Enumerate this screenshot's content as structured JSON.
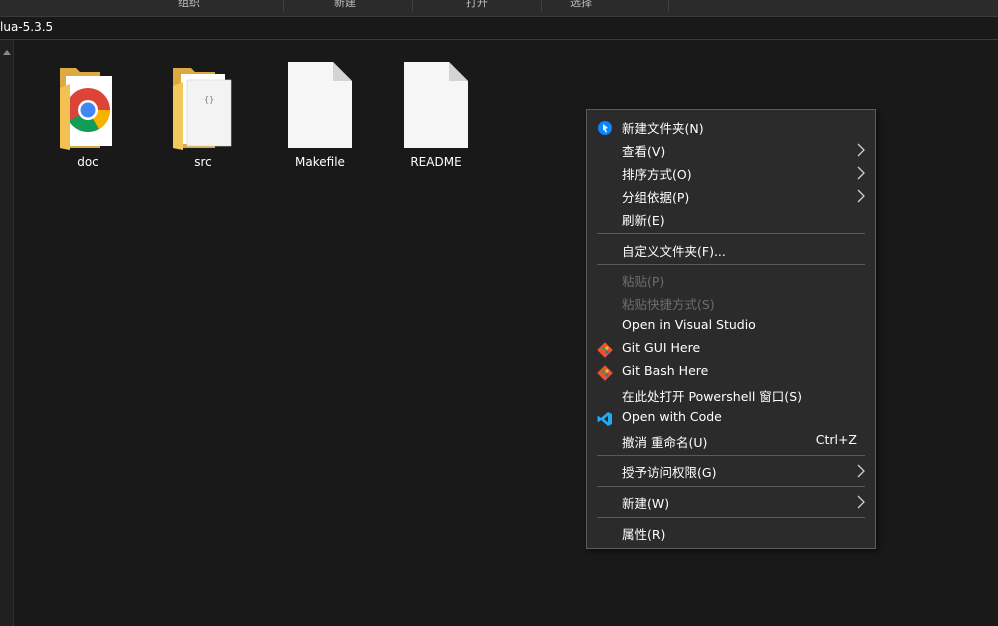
{
  "ribbon": {
    "items": [
      "组织",
      "新建",
      "打开",
      "选择"
    ]
  },
  "address": {
    "path": "lua-5.3.5"
  },
  "files": [
    {
      "name": "doc",
      "icon": "folder-chrome-icon"
    },
    {
      "name": "src",
      "icon": "folder-icon"
    },
    {
      "name": "Makefile",
      "icon": "file-icon"
    },
    {
      "name": "README",
      "icon": "file-icon"
    }
  ],
  "context_menu": {
    "items": [
      {
        "label": "新建文件夹(N)",
        "icon": "new-folder-pin-icon"
      },
      {
        "label": "查看(V)",
        "submenu": true
      },
      {
        "label": "排序方式(O)",
        "submenu": true
      },
      {
        "label": "分组依据(P)",
        "submenu": true
      },
      {
        "label": "刷新(E)"
      },
      {
        "label": "自定义文件夹(F)..."
      },
      {
        "label": "粘贴(P)",
        "disabled": true
      },
      {
        "label": "粘贴快捷方式(S)",
        "disabled": true
      },
      {
        "label": "Open in Visual Studio"
      },
      {
        "label": "Git GUI Here",
        "icon": "git-icon"
      },
      {
        "label": "Git Bash Here",
        "icon": "git-icon"
      },
      {
        "label": "在此处打开 Powershell 窗口(S)"
      },
      {
        "label": "Open with Code",
        "icon": "vscode-icon"
      },
      {
        "label": "撤消 重命名(U)",
        "shortcut": "Ctrl+Z"
      },
      {
        "label": "授予访问权限(G)",
        "submenu": true
      },
      {
        "label": "新建(W)",
        "submenu": true
      },
      {
        "label": "属性(R)"
      }
    ]
  },
  "colors": {
    "background": "#191919",
    "menu_background": "#2b2b2b",
    "menu_border": "#5c5c5c",
    "disabled_text": "#6d6d6d",
    "folder_yellow": "#f3c85c",
    "git_orange": "#f05133",
    "vscode_blue": "#23a9f2"
  }
}
